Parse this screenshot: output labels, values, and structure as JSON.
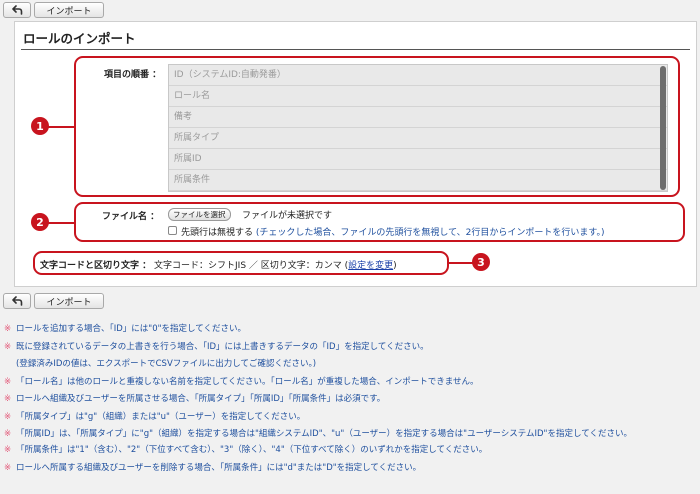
{
  "toolbar": {
    "back_icon": "back-arrow-icon",
    "import_label": "インポート"
  },
  "page_title": "ロールのインポート",
  "order": {
    "label": "項目の順番 ：",
    "items": [
      "ID（システムID:自動発番）",
      "ロール名",
      "備考",
      "所属タイプ",
      "所属ID",
      "所属条件"
    ]
  },
  "file": {
    "label": "ファイル名 ：",
    "choose_label": "ファイルを選択",
    "status": "ファイルが未選択です",
    "skip_header_label": "先頭行は無視する",
    "skip_header_note": "(チェックした場合、ファイルの先頭行を無視して、2行目からインポートを行います。)"
  },
  "encoding": {
    "label": "文字コードと区切り文字 ：",
    "value_text": "文字コード：シフトJIS ／ 区切り文字：カンマ (",
    "change_link": "設定を変更",
    "close_paren": ")"
  },
  "callouts": [
    "1",
    "2",
    "3"
  ],
  "notes": [
    "ロールを追加する場合、「ID」には\"0\"を指定してください。",
    "既に登録されているデータの上書きを行う場合、「ID」には上書きするデータの「ID」を指定してください。",
    "(登録済みIDの値は、エクスポートでCSVファイルに出力してご確認ください。)",
    "「ロール名」は他のロールと重複しない名前を指定してください。「ロール名」が重複した場合、インポートできません。",
    "ロールへ組織及びユーザーを所属させる場合、「所属タイプ」「所属ID」「所属条件」は必須です。",
    "「所属タイプ」は\"g\"（組織）または\"u\"（ユーザー）を指定してください。",
    "「所属ID」は、「所属タイプ」に\"g\"（組織）を指定する場合は\"組織システムID\"、\"u\"（ユーザー）を指定する場合は\"ユーザーシステムID\"を指定してください。",
    "「所属条件」は\"1\"（含む）、\"2\"（下位すべて含む）、\"3\"（除く）、\"4\"（下位すべて除く）のいずれかを指定してください。",
    "ロールへ所属する組織及びユーザーを削除する場合、「所属条件」には\"d\"または\"D\"を指定してください。"
  ],
  "note_mark": "※"
}
